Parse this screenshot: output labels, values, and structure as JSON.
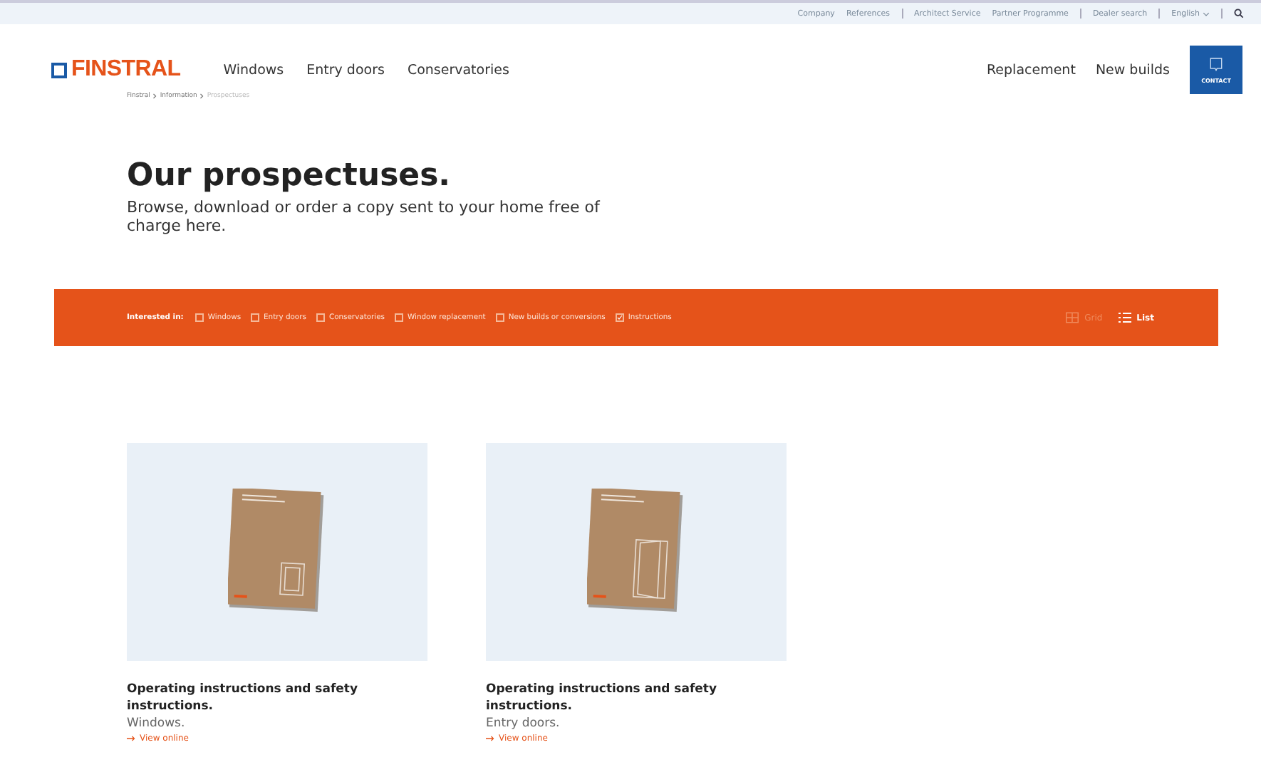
{
  "top_links": [
    "Company",
    "References",
    "Architect Service",
    "Partner Programme",
    "Dealer search",
    "English"
  ],
  "logo": "FINSTRAL",
  "main_nav": [
    "Windows",
    "Entry doors",
    "Conservatories"
  ],
  "side_nav": [
    "Replacement",
    "New builds"
  ],
  "contact": "CONTACT",
  "breadcrumb": [
    {
      "label": "Finstral",
      "current": false
    },
    {
      "label": "Information",
      "current": false
    },
    {
      "label": "Prospectuses",
      "current": true
    }
  ],
  "heading": "Our prospectuses.",
  "intro": "Browse, download or order a copy sent to your home free of charge here.",
  "filter": {
    "label": "Interested in:",
    "options": [
      {
        "label": "Windows",
        "checked": false
      },
      {
        "label": "Entry doors",
        "checked": false
      },
      {
        "label": "Conservatories",
        "checked": false
      },
      {
        "label": "Window replacement",
        "checked": false
      },
      {
        "label": "New builds or conversions",
        "checked": false
      },
      {
        "label": "Instructions",
        "checked": true
      }
    ]
  },
  "views": [
    {
      "label": "Grid",
      "kind": "grid",
      "selected": false
    },
    {
      "label": "List",
      "kind": "list",
      "selected": true
    }
  ],
  "cards": [
    {
      "title": "Operating instructions and safety instructions.",
      "subtitle": "Windows.",
      "link": "View online",
      "kind": "window"
    },
    {
      "title": "Operating instructions and safety instructions.",
      "subtitle": "Entry doors.",
      "link": "View online",
      "kind": "door"
    }
  ]
}
